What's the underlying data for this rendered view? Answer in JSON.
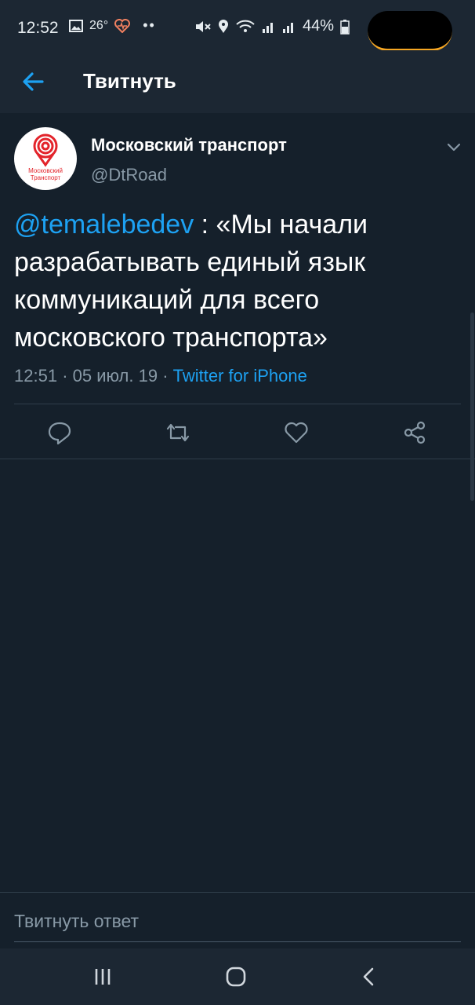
{
  "status_bar": {
    "time": "12:52",
    "temperature": "26°",
    "battery": "44%"
  },
  "header": {
    "title": "Твитнуть"
  },
  "tweet": {
    "author_name": "Московский транспорт",
    "author_handle": "@DtRoad",
    "avatar_text_line1": "Московский",
    "avatar_text_line2": "Транспорт",
    "mention": "@temalebedev",
    "text": " : «Мы начали разрабатывать единый язык коммуникаций для всего московского транспорта»",
    "time": "12:51",
    "date": "05 июл. 19",
    "source": "Twitter for iPhone"
  },
  "reply": {
    "placeholder": "Твитнуть ответ"
  },
  "colors": {
    "background": "#15202b",
    "bar": "#1c2733",
    "accent": "#1da1f2",
    "muted": "#8899a6",
    "brand_red": "#e3242b"
  }
}
